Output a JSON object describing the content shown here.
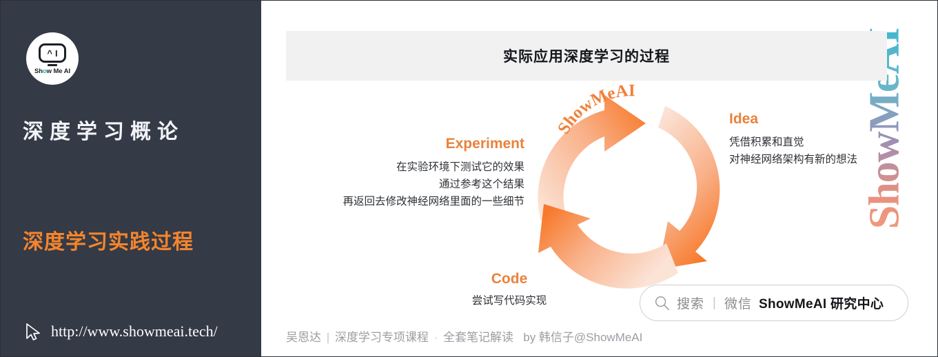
{
  "sidebar": {
    "logo": {
      "icon_name": "showmeai-robot-logo",
      "face_left": "^",
      "face_right": "I",
      "brand_pre": "Sh",
      "brand_dot": "o",
      "brand_post": "w Me AI"
    },
    "course_title": "深度学习概论",
    "lesson_title": "深度学习实践过程",
    "cursor_icon": "cursor-pointer-icon",
    "url": "http://www.showmeai.tech/"
  },
  "main": {
    "slide_title": "实际应用深度学习的过程",
    "watermark_vertical": "ShowMeAI",
    "watermark_arc": "ShowMeAI",
    "diagram": {
      "type": "cycle",
      "nodes": [
        {
          "id": "idea",
          "heading": "Idea",
          "lines": [
            "凭借积累和直觉",
            "对神经网络架构有新的想法"
          ]
        },
        {
          "id": "code",
          "heading": "Code",
          "lines": [
            "尝试写代码实现"
          ]
        },
        {
          "id": "experiment",
          "heading": "Experiment",
          "lines": [
            "在实验环境下测试它的效果",
            "通过参考这个结果",
            "再返回去修改神经网络里面的一些细节"
          ]
        }
      ]
    },
    "search": {
      "icon_name": "magnifier-icon",
      "placeholder_grey": "搜索",
      "divider": "|",
      "channel": "微信",
      "account": "ShowMeAI 研究中心"
    },
    "footer": {
      "author": "吴恩达",
      "sep1": "|",
      "course": "深度学习专项课程",
      "dot": "·",
      "notes": "全套笔记解读",
      "by": "by 韩信子@ShowMeAI"
    }
  },
  "colors": {
    "sidebar_bg": "#343a46",
    "accent_orange": "#f5852c",
    "arrow_orange": "#f7792b",
    "heading_orange": "#e8823c",
    "title_bar_bg": "#f1f1f1"
  }
}
